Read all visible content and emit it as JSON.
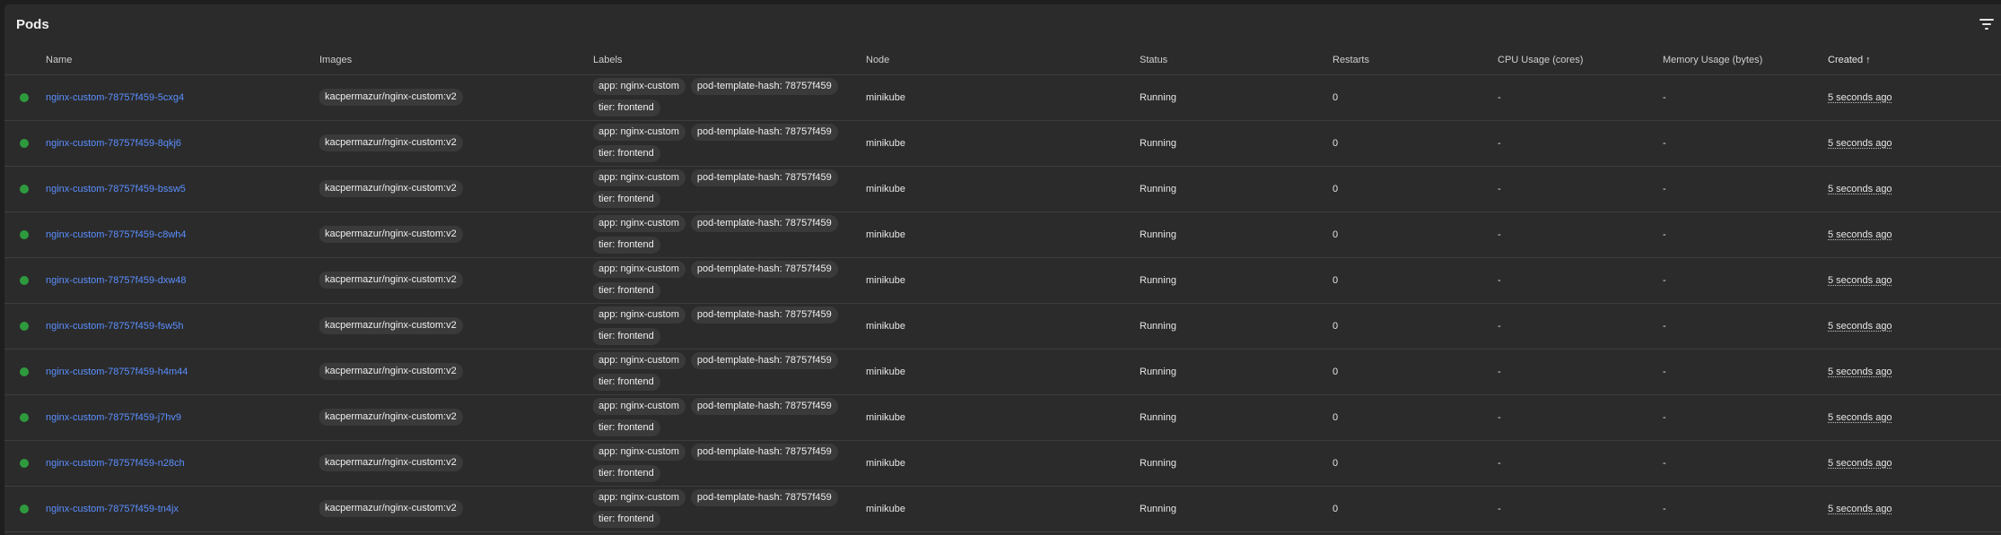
{
  "panel": {
    "title": "Pods",
    "filter_icon": "filter-list-icon"
  },
  "columns": {
    "name": "Name",
    "images": "Images",
    "labels": "Labels",
    "node": "Node",
    "status": "Status",
    "restarts": "Restarts",
    "cpu": "CPU Usage (cores)",
    "memory": "Memory Usage (bytes)",
    "created": "Created",
    "created_sort": "↑"
  },
  "colors": {
    "status_running": "#2e9a3e",
    "link": "#5b8fff",
    "background": "#2b2b2b"
  },
  "pods": [
    {
      "name": "nginx-custom-78757f459-5cxg4",
      "image": "kacpermazur/nginx-custom:v2",
      "labels": [
        "app: nginx-custom",
        "pod-template-hash: 78757f459",
        "tier: frontend"
      ],
      "node": "minikube",
      "status": "Running",
      "restarts": "0",
      "cpu": "-",
      "memory": "-",
      "created": "5 seconds ago"
    },
    {
      "name": "nginx-custom-78757f459-8qkj6",
      "image": "kacpermazur/nginx-custom:v2",
      "labels": [
        "app: nginx-custom",
        "pod-template-hash: 78757f459",
        "tier: frontend"
      ],
      "node": "minikube",
      "status": "Running",
      "restarts": "0",
      "cpu": "-",
      "memory": "-",
      "created": "5 seconds ago"
    },
    {
      "name": "nginx-custom-78757f459-bssw5",
      "image": "kacpermazur/nginx-custom:v2",
      "labels": [
        "app: nginx-custom",
        "pod-template-hash: 78757f459",
        "tier: frontend"
      ],
      "node": "minikube",
      "status": "Running",
      "restarts": "0",
      "cpu": "-",
      "memory": "-",
      "created": "5 seconds ago"
    },
    {
      "name": "nginx-custom-78757f459-c8wh4",
      "image": "kacpermazur/nginx-custom:v2",
      "labels": [
        "app: nginx-custom",
        "pod-template-hash: 78757f459",
        "tier: frontend"
      ],
      "node": "minikube",
      "status": "Running",
      "restarts": "0",
      "cpu": "-",
      "memory": "-",
      "created": "5 seconds ago"
    },
    {
      "name": "nginx-custom-78757f459-dxw48",
      "image": "kacpermazur/nginx-custom:v2",
      "labels": [
        "app: nginx-custom",
        "pod-template-hash: 78757f459",
        "tier: frontend"
      ],
      "node": "minikube",
      "status": "Running",
      "restarts": "0",
      "cpu": "-",
      "memory": "-",
      "created": "5 seconds ago"
    },
    {
      "name": "nginx-custom-78757f459-fsw5h",
      "image": "kacpermazur/nginx-custom:v2",
      "labels": [
        "app: nginx-custom",
        "pod-template-hash: 78757f459",
        "tier: frontend"
      ],
      "node": "minikube",
      "status": "Running",
      "restarts": "0",
      "cpu": "-",
      "memory": "-",
      "created": "5 seconds ago"
    },
    {
      "name": "nginx-custom-78757f459-h4m44",
      "image": "kacpermazur/nginx-custom:v2",
      "labels": [
        "app: nginx-custom",
        "pod-template-hash: 78757f459",
        "tier: frontend"
      ],
      "node": "minikube",
      "status": "Running",
      "restarts": "0",
      "cpu": "-",
      "memory": "-",
      "created": "5 seconds ago"
    },
    {
      "name": "nginx-custom-78757f459-j7hv9",
      "image": "kacpermazur/nginx-custom:v2",
      "labels": [
        "app: nginx-custom",
        "pod-template-hash: 78757f459",
        "tier: frontend"
      ],
      "node": "minikube",
      "status": "Running",
      "restarts": "0",
      "cpu": "-",
      "memory": "-",
      "created": "5 seconds ago"
    },
    {
      "name": "nginx-custom-78757f459-n28ch",
      "image": "kacpermazur/nginx-custom:v2",
      "labels": [
        "app: nginx-custom",
        "pod-template-hash: 78757f459",
        "tier: frontend"
      ],
      "node": "minikube",
      "status": "Running",
      "restarts": "0",
      "cpu": "-",
      "memory": "-",
      "created": "5 seconds ago"
    },
    {
      "name": "nginx-custom-78757f459-tn4jx",
      "image": "kacpermazur/nginx-custom:v2",
      "labels": [
        "app: nginx-custom",
        "pod-template-hash: 78757f459",
        "tier: frontend"
      ],
      "node": "minikube",
      "status": "Running",
      "restarts": "0",
      "cpu": "-",
      "memory": "-",
      "created": "5 seconds ago"
    }
  ]
}
